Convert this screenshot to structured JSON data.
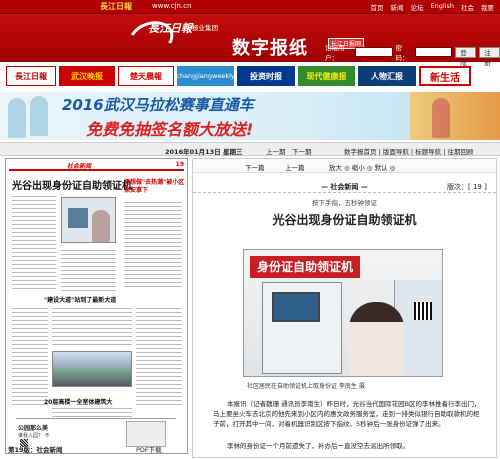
{
  "topbar": {
    "brand": "長江日報",
    "url": "www.cjn.cn",
    "nav": [
      "首页",
      "新闻",
      "论坛",
      "English",
      "社会",
      "我要"
    ]
  },
  "header": {
    "logo": "長江日報",
    "group": "报业集团",
    "title": "数字报纸",
    "sub": "长江日报网",
    "login": {
      "user_label": "论坛用户：",
      "pass_label": "密码：",
      "login_btn": "登陆",
      "register_btn": "注册"
    }
  },
  "papers": [
    "長江日報",
    "武汉晚报",
    "楚天晨報",
    "changjiangweekly",
    "投资时报",
    "现代健康报",
    "人物汇报",
    "新生活"
  ],
  "banner": {
    "line1": "2016武汉马拉松赛事直通车",
    "line2": "免费免抽签名额大放送!"
  },
  "dateline": {
    "date": "2016年01月13日  星期三",
    "prev": "上一期",
    "next": "下一期",
    "links": "数字报首页 | 版面导航 | 标题导航 | 往期回顾"
  },
  "page": {
    "number": "19",
    "section": "社会新闻",
    "headline": "光谷出现身份证自助领证机",
    "mid_headline": "\"建设大道\"站到了最新大道",
    "lower_headline": "20层高楼一全室体建筑大",
    "right_headline": "再想做\"去热潮\"被小区保安拿下",
    "ad_title": "公园那么美",
    "ad_sub": "谁我入园？ 不",
    "footer_label": "第19版：社会新闻",
    "footer_pdf": "PDF下载"
  },
  "article": {
    "tools": {
      "next": "下一篇",
      "prev": "上一篇",
      "fontsize": "放大 ◎ 缩小 ◎ 默认 ◎"
    },
    "section": "— 社会新闻 —",
    "section_prev": "版次：[ 19 ]",
    "subtitle": "按下手指，五秒钟领证",
    "title": "光谷出现身份证自助领证机",
    "photo_sign": "身份证自助领证机",
    "caption": "社区居民在自助领证机上取身份证    李南生  摄",
    "body1": "本报讯（记者魏珊 通讯员李南生）昨日时，光谷当代国际花园B区的李林推着行李出门，马上要坐火车去北京的他先来到小区内的惠文政务服务室，走到一排类似银行自助取款机的柜子前，打开其中一间，对着机器识别区按下指纹，5秒钟后一张身份证弹了出来。",
    "body2": "李林的身份证一个月前遗失了，补办后一直没空去派出所领取。"
  }
}
